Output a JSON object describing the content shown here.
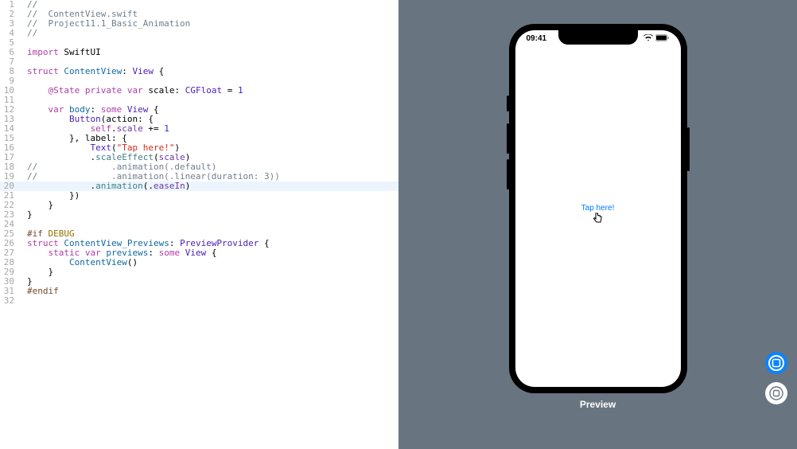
{
  "code": {
    "lines": [
      {
        "n": 1,
        "seg": [
          {
            "c": "c-comment",
            "t": "//"
          }
        ]
      },
      {
        "n": 2,
        "seg": [
          {
            "c": "c-comment",
            "t": "//  ContentView.swift"
          }
        ]
      },
      {
        "n": 3,
        "seg": [
          {
            "c": "c-comment",
            "t": "//  Project11.1_Basic_Animation"
          }
        ]
      },
      {
        "n": 4,
        "seg": [
          {
            "c": "c-comment",
            "t": "//"
          }
        ]
      },
      {
        "n": 5,
        "seg": []
      },
      {
        "n": 6,
        "seg": [
          {
            "c": "c-keyword",
            "t": "import"
          },
          {
            "c": "c-plain",
            "t": " SwiftUI"
          }
        ]
      },
      {
        "n": 7,
        "seg": []
      },
      {
        "n": 8,
        "seg": [
          {
            "c": "c-keyword",
            "t": "struct"
          },
          {
            "c": "c-plain",
            "t": " "
          },
          {
            "c": "c-typedef",
            "t": "ContentView"
          },
          {
            "c": "c-plain",
            "t": ": "
          },
          {
            "c": "c-type",
            "t": "View"
          },
          {
            "c": "c-plain",
            "t": " {"
          }
        ]
      },
      {
        "n": 9,
        "seg": []
      },
      {
        "n": 10,
        "seg": [
          {
            "c": "c-plain",
            "t": "    "
          },
          {
            "c": "c-keyword",
            "t": "@State"
          },
          {
            "c": "c-plain",
            "t": " "
          },
          {
            "c": "c-keyword",
            "t": "private var"
          },
          {
            "c": "c-plain",
            "t": " scale: "
          },
          {
            "c": "c-type",
            "t": "CGFloat"
          },
          {
            "c": "c-plain",
            "t": " = "
          },
          {
            "c": "c-num",
            "t": "1"
          }
        ]
      },
      {
        "n": 11,
        "seg": []
      },
      {
        "n": 12,
        "seg": [
          {
            "c": "c-plain",
            "t": "    "
          },
          {
            "c": "c-keyword",
            "t": "var"
          },
          {
            "c": "c-plain",
            "t": " "
          },
          {
            "c": "c-typedef",
            "t": "body"
          },
          {
            "c": "c-plain",
            "t": ": "
          },
          {
            "c": "c-keyword",
            "t": "some"
          },
          {
            "c": "c-plain",
            "t": " "
          },
          {
            "c": "c-type",
            "t": "View"
          },
          {
            "c": "c-plain",
            "t": " {"
          }
        ]
      },
      {
        "n": 13,
        "seg": [
          {
            "c": "c-plain",
            "t": "        "
          },
          {
            "c": "c-type",
            "t": "Button"
          },
          {
            "c": "c-plain",
            "t": "(action: {"
          }
        ]
      },
      {
        "n": 14,
        "seg": [
          {
            "c": "c-plain",
            "t": "            "
          },
          {
            "c": "c-keyword",
            "t": "self"
          },
          {
            "c": "c-plain",
            "t": "."
          },
          {
            "c": "c-prop",
            "t": "scale"
          },
          {
            "c": "c-plain",
            "t": " += "
          },
          {
            "c": "c-num",
            "t": "1"
          }
        ]
      },
      {
        "n": 15,
        "seg": [
          {
            "c": "c-plain",
            "t": "        }, label: {"
          }
        ]
      },
      {
        "n": 16,
        "seg": [
          {
            "c": "c-plain",
            "t": "            "
          },
          {
            "c": "c-type",
            "t": "Text"
          },
          {
            "c": "c-plain",
            "t": "("
          },
          {
            "c": "c-string",
            "t": "\"Tap here!\""
          },
          {
            "c": "c-plain",
            "t": ")"
          }
        ]
      },
      {
        "n": 17,
        "seg": [
          {
            "c": "c-plain",
            "t": "            ."
          },
          {
            "c": "c-ident",
            "t": "scaleEffect"
          },
          {
            "c": "c-plain",
            "t": "("
          },
          {
            "c": "c-prop",
            "t": "scale"
          },
          {
            "c": "c-plain",
            "t": ")"
          }
        ]
      },
      {
        "n": 18,
        "seg": [
          {
            "c": "c-comment",
            "t": "//              .animation(.default)"
          }
        ]
      },
      {
        "n": 19,
        "seg": [
          {
            "c": "c-comment",
            "t": "//              .animation(.linear(duration: 3))"
          }
        ]
      },
      {
        "n": 20,
        "hl": true,
        "seg": [
          {
            "c": "c-plain",
            "t": "            ."
          },
          {
            "c": "c-ident",
            "t": "animation"
          },
          {
            "c": "c-plain",
            "t": "(."
          },
          {
            "c": "c-prop",
            "t": "easeIn"
          },
          {
            "c": "c-plain",
            "t": ")"
          }
        ]
      },
      {
        "n": 21,
        "seg": [
          {
            "c": "c-plain",
            "t": "        })"
          }
        ]
      },
      {
        "n": 22,
        "seg": [
          {
            "c": "c-plain",
            "t": "    }"
          }
        ]
      },
      {
        "n": 23,
        "seg": [
          {
            "c": "c-plain",
            "t": "}"
          }
        ]
      },
      {
        "n": 24,
        "seg": []
      },
      {
        "n": 25,
        "seg": [
          {
            "c": "c-pre",
            "t": "#if"
          },
          {
            "c": "c-plain",
            "t": " "
          },
          {
            "c": "c-attr",
            "t": "DEBUG"
          }
        ]
      },
      {
        "n": 26,
        "seg": [
          {
            "c": "c-keyword",
            "t": "struct"
          },
          {
            "c": "c-plain",
            "t": " "
          },
          {
            "c": "c-typedef",
            "t": "ContentView_Previews"
          },
          {
            "c": "c-plain",
            "t": ": "
          },
          {
            "c": "c-type",
            "t": "PreviewProvider"
          },
          {
            "c": "c-plain",
            "t": " {"
          }
        ]
      },
      {
        "n": 27,
        "seg": [
          {
            "c": "c-plain",
            "t": "    "
          },
          {
            "c": "c-keyword",
            "t": "static var"
          },
          {
            "c": "c-plain",
            "t": " "
          },
          {
            "c": "c-typedef",
            "t": "previews"
          },
          {
            "c": "c-plain",
            "t": ": "
          },
          {
            "c": "c-keyword",
            "t": "some"
          },
          {
            "c": "c-plain",
            "t": " "
          },
          {
            "c": "c-type",
            "t": "View"
          },
          {
            "c": "c-plain",
            "t": " {"
          }
        ]
      },
      {
        "n": 28,
        "seg": [
          {
            "c": "c-plain",
            "t": "        "
          },
          {
            "c": "c-typedef",
            "t": "ContentView"
          },
          {
            "c": "c-plain",
            "t": "()"
          }
        ]
      },
      {
        "n": 29,
        "seg": [
          {
            "c": "c-plain",
            "t": "    }"
          }
        ]
      },
      {
        "n": 30,
        "seg": [
          {
            "c": "c-plain",
            "t": "}"
          }
        ]
      },
      {
        "n": 31,
        "seg": [
          {
            "c": "c-pre",
            "t": "#endif"
          }
        ]
      },
      {
        "n": 32,
        "seg": []
      }
    ]
  },
  "preview": {
    "label": "Preview",
    "status_time": "09:41",
    "tap_text": "Tap here!"
  }
}
